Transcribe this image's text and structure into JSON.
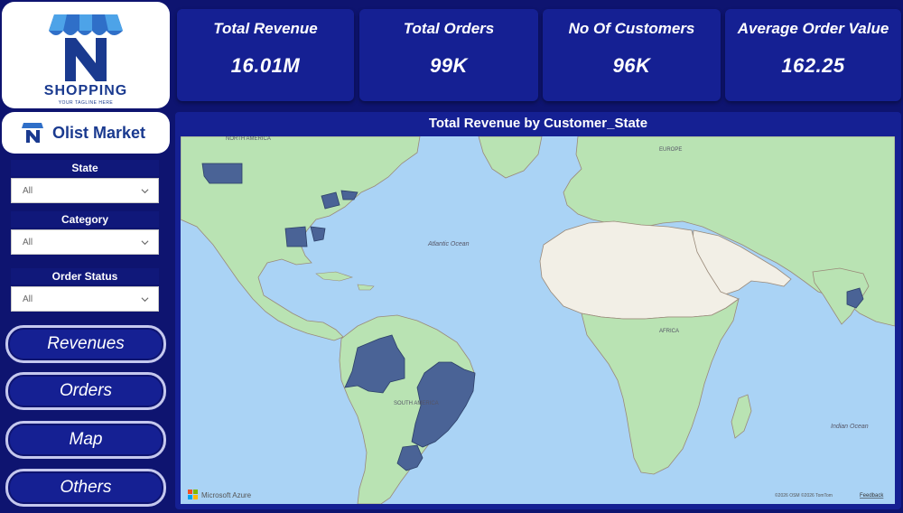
{
  "logo": {
    "name": "SHOPPING",
    "tagline": "YOUR TAGLINE HERE"
  },
  "brand": {
    "title": "Olist Market"
  },
  "filters": [
    {
      "label": "State",
      "value": "All"
    },
    {
      "label": "Category",
      "value": "All"
    },
    {
      "label": "Order Status",
      "value": "All"
    }
  ],
  "nav": [
    {
      "label": "Revenues"
    },
    {
      "label": "Orders"
    },
    {
      "label": "Map"
    },
    {
      "label": "Others"
    }
  ],
  "kpis": [
    {
      "label": "Total Revenue",
      "value": "16.01M"
    },
    {
      "label": "Total Orders",
      "value": "99K"
    },
    {
      "label": "No Of Customers",
      "value": "96K"
    },
    {
      "label": "Average Order Value",
      "value": "162.25"
    }
  ],
  "map": {
    "title": "Total Revenue by Customer_State",
    "labels": {
      "north_america": "NORTH AMERICA",
      "europe": "EUROPE",
      "atlantic": "Atlantic Ocean",
      "africa": "AFRICA",
      "south_america": "SOUTH AMERICA",
      "indian": "Indian Ocean"
    },
    "attribution": "Microsoft Azure",
    "copyright": "©2026 OSM ©2026 TomTom",
    "feedback": "Feedback",
    "colors": {
      "water": "#aad3f5",
      "land": "#b9e3b3",
      "desert": "#f2efe6",
      "highlight": "#4a6396"
    }
  }
}
